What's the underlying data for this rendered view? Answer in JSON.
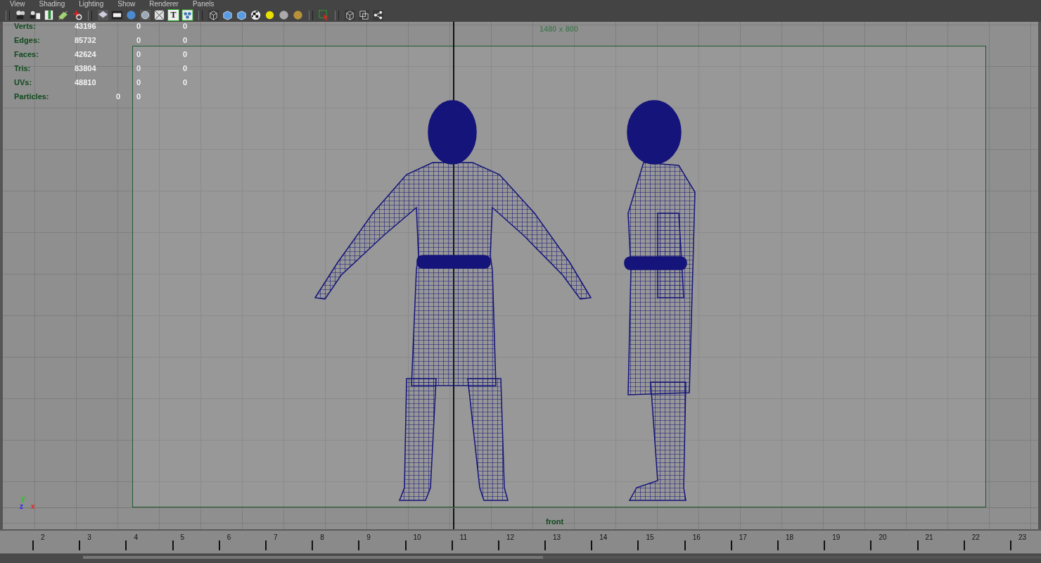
{
  "menu": [
    "View",
    "Shading",
    "Lighting",
    "Show",
    "Renderer",
    "Panels"
  ],
  "toolbar": {
    "text_tool_label": "T"
  },
  "stats": [
    {
      "kind": "mesh",
      "label": "Verts:",
      "values": [
        "43196",
        "0",
        "0"
      ]
    },
    {
      "kind": "mesh",
      "label": "Edges:",
      "values": [
        "85732",
        "0",
        "0"
      ]
    },
    {
      "kind": "mesh",
      "label": "Faces:",
      "values": [
        "42624",
        "0",
        "0"
      ]
    },
    {
      "kind": "mesh",
      "label": "Tris:",
      "values": [
        "83804",
        "0",
        "0"
      ]
    },
    {
      "kind": "mesh",
      "label": "UVs:",
      "values": [
        "48810",
        "0",
        "0"
      ]
    },
    {
      "kind": "particles",
      "label": "Particles:",
      "values": [
        "0",
        "0"
      ]
    }
  ],
  "viewport": {
    "resolution": "1480 x 800",
    "camera": "front",
    "axis_labels": [
      "y",
      "z",
      "x"
    ]
  },
  "range_slider": {
    "level": 0.48
  },
  "timeline": {
    "frames": [
      "2",
      "3",
      "4",
      "5",
      "6",
      "7",
      "8",
      "9",
      "10",
      "11",
      "12",
      "13",
      "14",
      "15",
      "16",
      "17",
      "18",
      "19",
      "20",
      "21",
      "22",
      "23"
    ]
  }
}
